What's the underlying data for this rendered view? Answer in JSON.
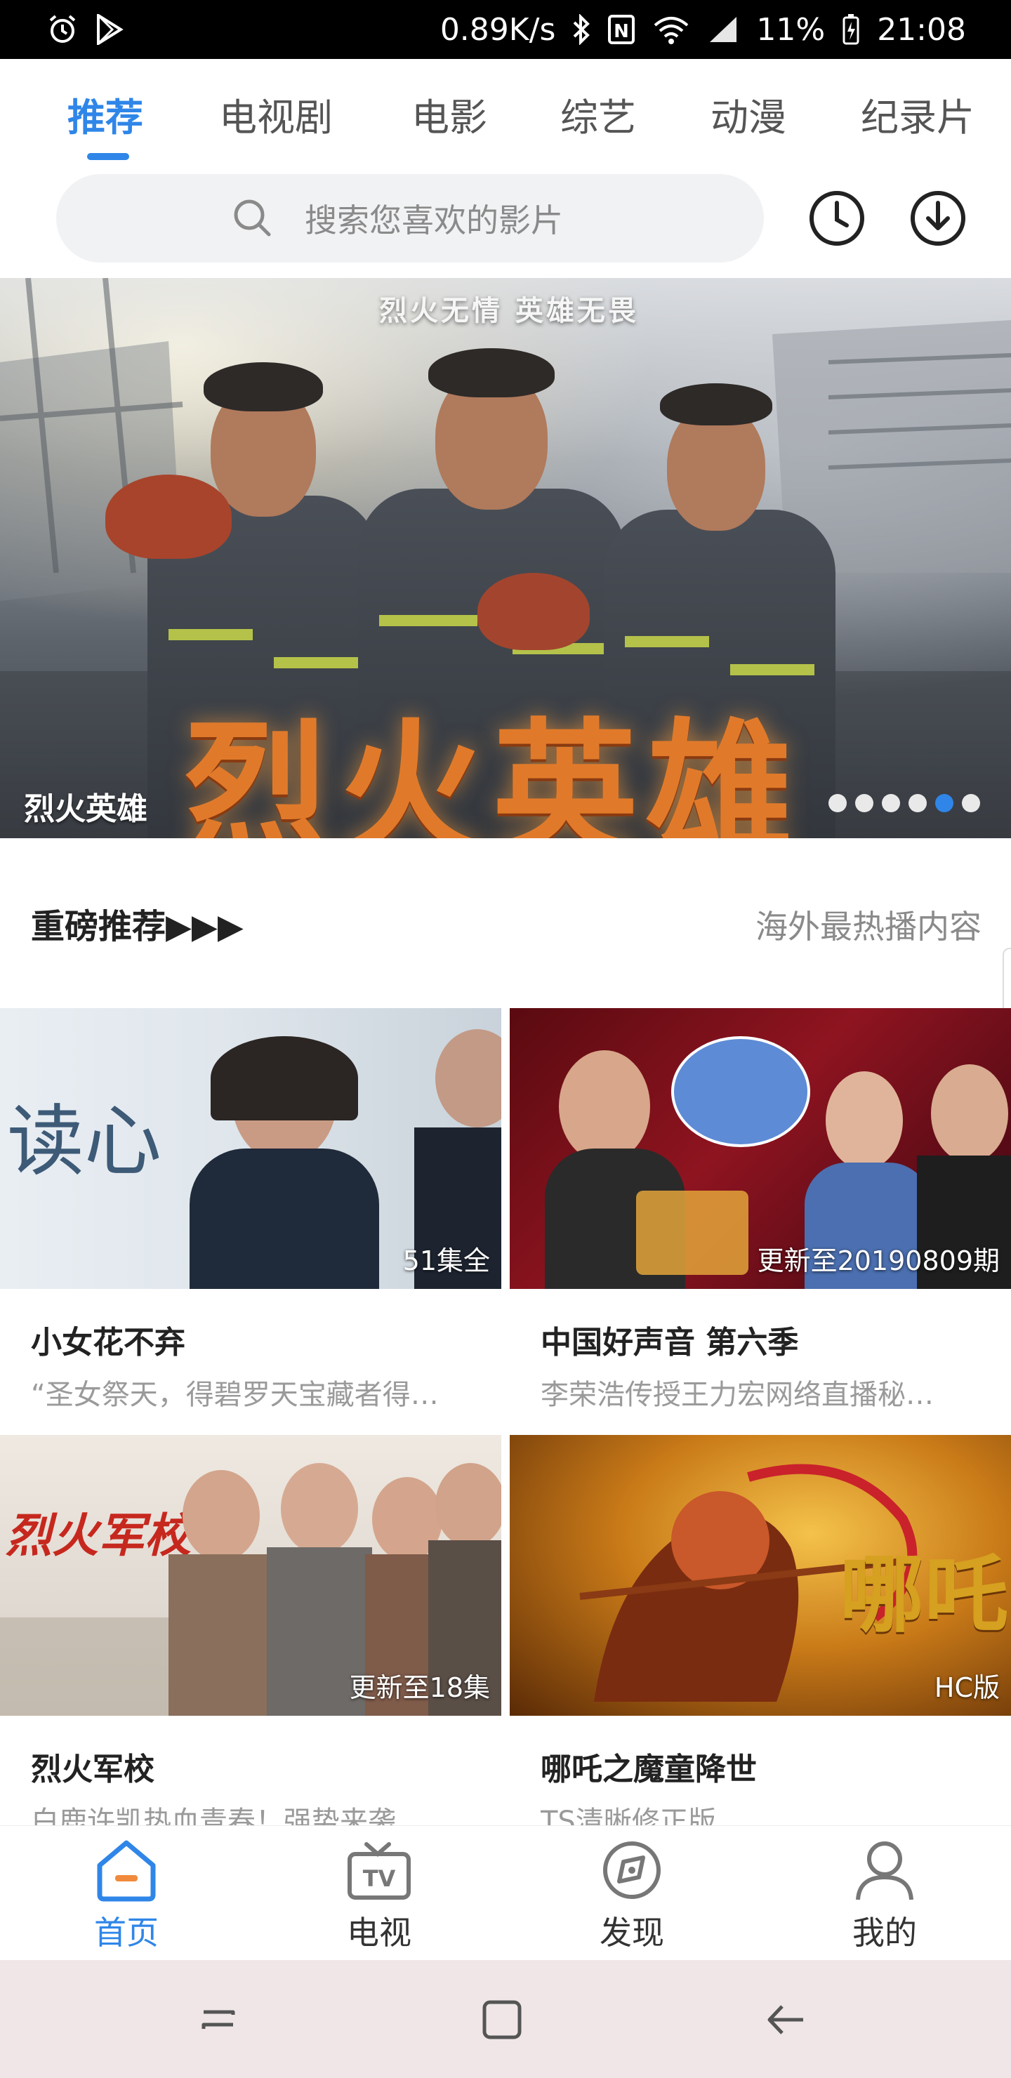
{
  "status_bar": {
    "network_speed": "0.89K/s",
    "battery": "11%",
    "time": "21:08"
  },
  "tabs": [
    {
      "label": "推荐",
      "active": true
    },
    {
      "label": "电视剧"
    },
    {
      "label": "电影"
    },
    {
      "label": "综艺"
    },
    {
      "label": "动漫"
    },
    {
      "label": "纪录片"
    }
  ],
  "search": {
    "placeholder": "搜索您喜欢的影片",
    "history_icon": "clock-icon",
    "download_icon": "download-icon"
  },
  "banner": {
    "slogan": "烈火无情 英雄无畏",
    "artwork_title": "烈火英雄",
    "caption": "烈火英雄",
    "total_slides": 6,
    "active_slide": 5
  },
  "section": {
    "title": "重磅推荐▶▶▶",
    "subtitle": "海外最热播内容"
  },
  "cards": [
    {
      "title": "小女花不弃",
      "desc": "“圣女祭天，得碧罗天宝藏者得…",
      "badge": "51集全",
      "thumb_text": "读心"
    },
    {
      "title": "中国好声音 第六季",
      "desc": "李荣浩传授王力宏网络直播秘…",
      "badge": "更新至20190809期"
    },
    {
      "title": "烈火军校",
      "desc": "白鹿许凯热血青春！强势来袭",
      "badge": "更新至18集",
      "thumb_text": "烈火军校"
    },
    {
      "title": "哪吒之魔童降世",
      "desc": "TS清晰修正版",
      "badge": "HC版",
      "thumb_text": "哪吒"
    }
  ],
  "bottom_nav": [
    {
      "label": "首页",
      "icon": "home-icon",
      "active": true
    },
    {
      "label": "电视",
      "icon": "tv-icon"
    },
    {
      "label": "发现",
      "icon": "compass-icon"
    },
    {
      "label": "我的",
      "icon": "user-icon"
    }
  ],
  "colors": {
    "accent": "#2f86e8",
    "home_accent": "#f08a3c"
  }
}
